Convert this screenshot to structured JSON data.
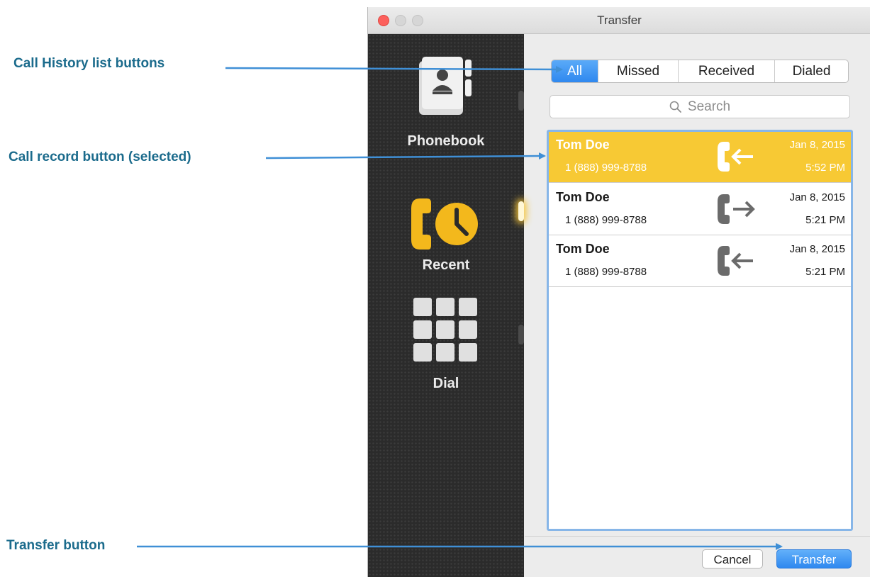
{
  "annotations": {
    "call_history": "Call History list buttons",
    "call_record": "Call record button (selected)",
    "transfer": "Transfer button"
  },
  "window": {
    "title": "Transfer"
  },
  "sidebar": {
    "items": [
      {
        "label": "Phonebook",
        "icon": "phonebook-icon"
      },
      {
        "label": "Recent",
        "icon": "recent-icon",
        "active": true
      },
      {
        "label": "Dial",
        "icon": "dialpad-icon"
      }
    ]
  },
  "filters": {
    "tabs": [
      "All",
      "Missed",
      "Received",
      "Dialed"
    ],
    "selected": "All"
  },
  "search": {
    "placeholder": "Search"
  },
  "calls": [
    {
      "name": "Tom Doe",
      "number": "1 (888) 999-8788",
      "date": "Jan 8, 2015",
      "time": "5:52 PM",
      "direction": "incoming",
      "selected": true
    },
    {
      "name": "Tom Doe",
      "number": "1 (888) 999-8788",
      "date": "Jan 8, 2015",
      "time": "5:21 PM",
      "direction": "outgoing",
      "selected": false
    },
    {
      "name": "Tom Doe",
      "number": "1 (888) 999-8788",
      "date": "Jan 8, 2015",
      "time": "5:21 PM",
      "direction": "incoming",
      "selected": false
    }
  ],
  "buttons": {
    "cancel": "Cancel",
    "transfer": "Transfer"
  },
  "colors": {
    "selected_row": "#f7c934",
    "accent": "#2f88ef",
    "callout_text": "#1b6b8c",
    "arrow": "#3f8fd6"
  }
}
